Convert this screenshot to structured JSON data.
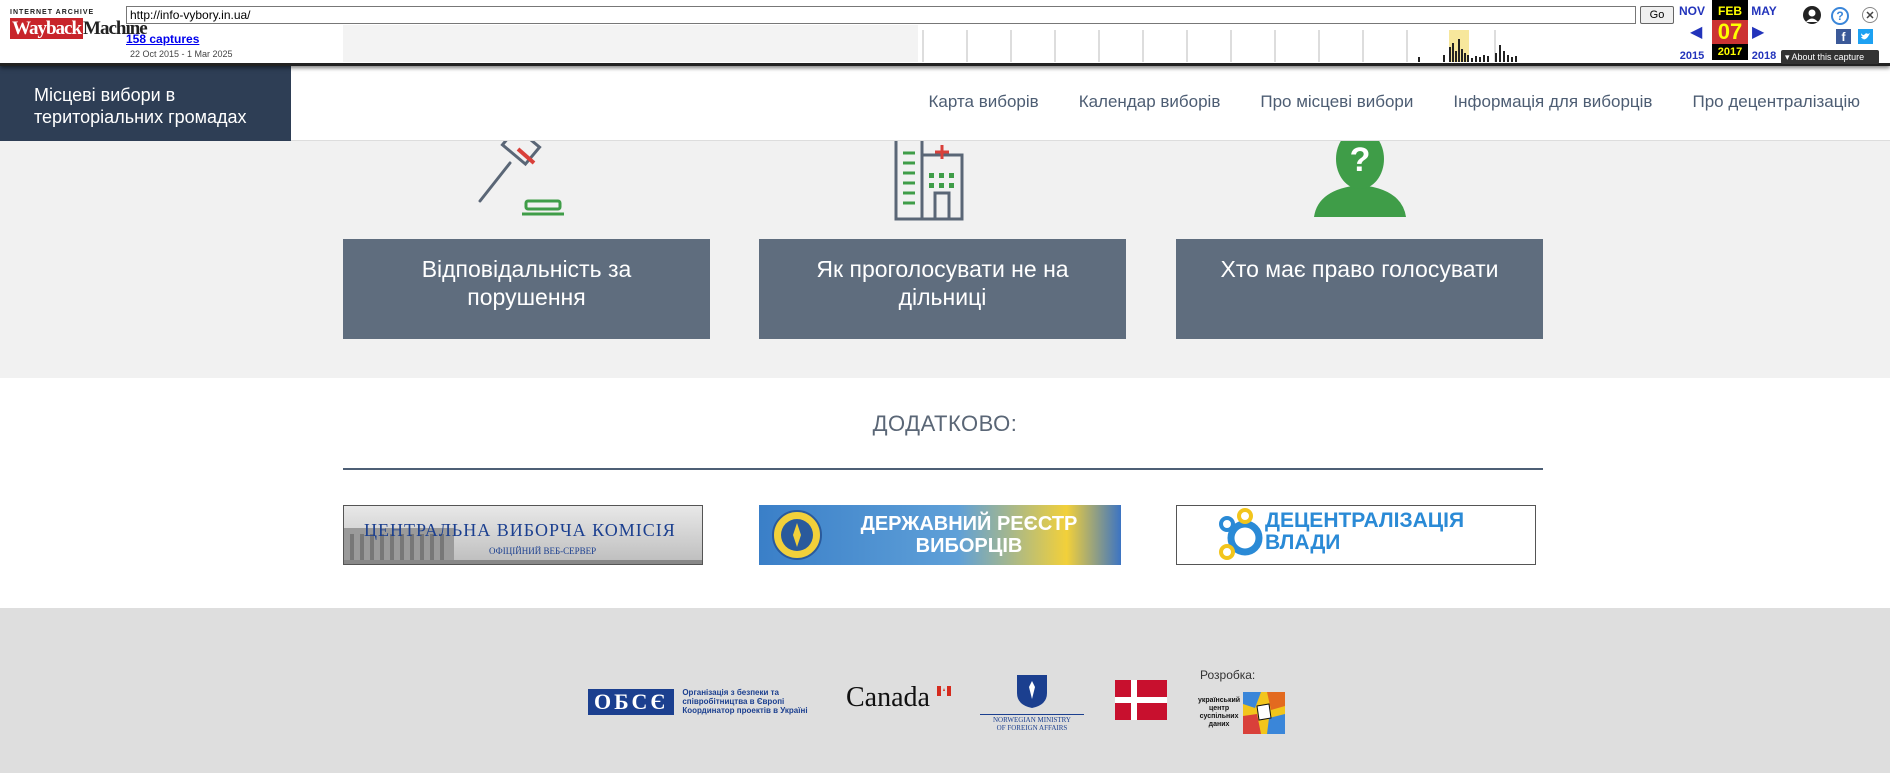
{
  "wayback": {
    "logo_top": "INTERNET ARCHIVE",
    "logo_wayback": "Wayback",
    "logo_machine": "Machine",
    "url": "http://info-vybory.in.ua/",
    "go_label": "Go",
    "captures": "158 captures",
    "range": "22 Oct 2015 - 1 Mar 2025",
    "prev_month": "NOV",
    "prev_year": "2015",
    "cur_month": "FEB",
    "cur_day": "07",
    "cur_year": "2017",
    "next_month": "MAY",
    "next_year": "2018",
    "about": "About this capture"
  },
  "header": {
    "brand_line1": "Місцеві вибори в",
    "brand_line2": "територіальних громадах",
    "nav": [
      {
        "label": "Карта виборів"
      },
      {
        "label": "Календар виборів"
      },
      {
        "label": "Про місцеві вибори"
      },
      {
        "label": "Інформація для виборців"
      },
      {
        "label": "Про децентралізацію"
      }
    ]
  },
  "cards": [
    {
      "line1": "Відповідальність за",
      "line2": "порушення",
      "icon": "gavel-icon"
    },
    {
      "line1": "Як проголосувати не на",
      "line2": "дільниці",
      "icon": "hospital-icon"
    },
    {
      "line1": "Хто має право голосувати",
      "line2": "",
      "icon": "person-question-icon"
    }
  ],
  "extra": {
    "title": "ДОДАТКОВО:",
    "banners": [
      {
        "line1": "ЦЕНТРАЛЬНА ВИБОРЧА КОМІСІЯ",
        "line2": "ОФІЦІЙНИЙ ВЕБ-СЕРВЕР"
      },
      {
        "line1": "ДЕРЖАВНИЙ РЕЄСТР",
        "line2": "ВИБОРЦІВ"
      },
      {
        "line1": "ДЕЦЕНТРАЛІЗАЦІЯ",
        "line2": "ВЛАДИ"
      }
    ]
  },
  "footer": {
    "osce_abbr": "ОБСЄ",
    "osce_text1": "Організація з безпеки та",
    "osce_text2": "співробітництва в Європі",
    "osce_text3": "Координатор проектів в Україні",
    "canada": "Canada",
    "norway1": "NORWEGIAN MINISTRY",
    "norway2": "OF FOREIGN AFFAIRS",
    "dev_label": "Розробка:",
    "ucsd1": "український",
    "ucsd2": "центр",
    "ucsd3": "суспільних",
    "ucsd4": "даних"
  },
  "colors": {
    "brand_bg": "#2e3e55",
    "card_bg": "#5f6d7e",
    "icon_green": "#3f9d48",
    "icon_grey": "#5a6676",
    "accent_red": "#d9403a"
  }
}
